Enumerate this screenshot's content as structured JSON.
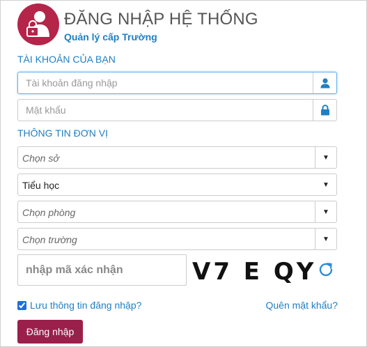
{
  "header": {
    "title": "ĐĂNG NHẬP HỆ THỐNG",
    "subtitle": "Quản lý cấp Trường"
  },
  "account_section": {
    "label": "TÀI KHOẢN CỦA BẠN",
    "username_placeholder": "Tài khoản đăng nhập",
    "password_placeholder": "Mật khẩu"
  },
  "unit_section": {
    "label": "THÔNG TIN ĐƠN VỊ",
    "department_placeholder": "Chọn sở",
    "level_value": "Tiểu học",
    "office_placeholder": "Chọn phòng",
    "school_placeholder": "Chọn trường"
  },
  "captcha": {
    "placeholder": "nhập mã xác nhận",
    "text": "V7 E QY"
  },
  "remember_label": "Lưu thông tin đăng nhập?",
  "forgot_label": "Quên mật khẩu?",
  "login_label": "Đăng nhập",
  "colors": {
    "accent": "#1f7fc2",
    "brand": "#b5254a",
    "button": "#9b1f4b"
  }
}
